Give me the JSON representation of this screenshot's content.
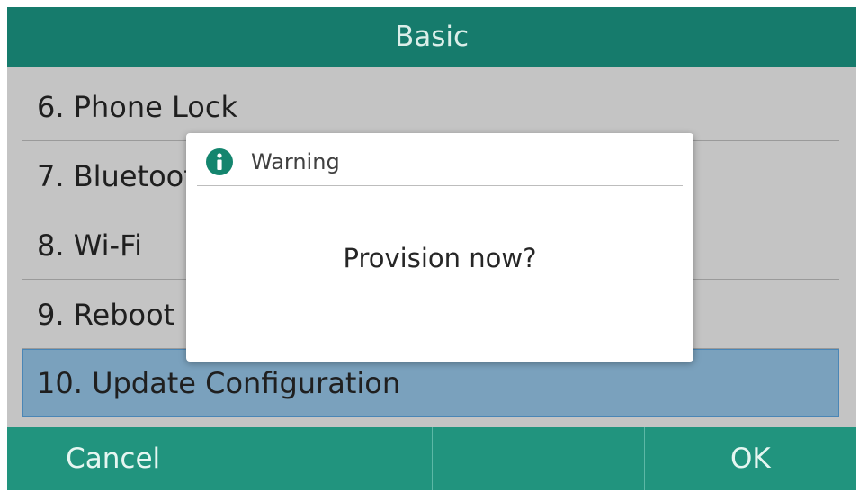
{
  "header": {
    "title": "Basic"
  },
  "menu": {
    "items": [
      {
        "label": "6. Phone Lock"
      },
      {
        "label": "7. Bluetooth"
      },
      {
        "label": "8. Wi-Fi"
      },
      {
        "label": "9. Reboot"
      },
      {
        "label": "10. Update Configuration",
        "selected": true
      }
    ]
  },
  "dialog": {
    "title": "Warning",
    "icon": "info-icon",
    "message": "Provision now?"
  },
  "softkeys": {
    "left": "Cancel",
    "middle1": "",
    "middle2": "",
    "right": "OK"
  },
  "colors": {
    "header_bg": "#167b6c",
    "softkey_bg": "#21947e",
    "selected_row": "#7aa1bd",
    "list_bg": "#c4c4c4",
    "info_icon": "#14856e"
  }
}
